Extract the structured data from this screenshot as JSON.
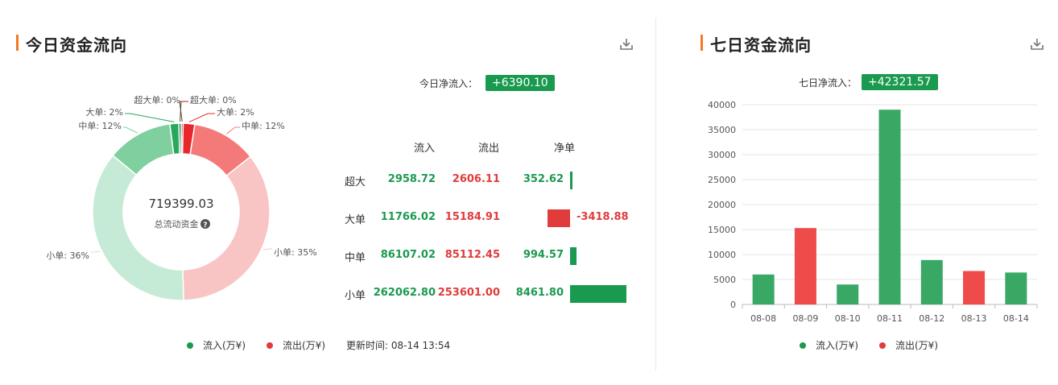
{
  "left_panel": {
    "title": "今日资金流向",
    "net_inflow_label": "今日净流入：",
    "net_inflow_value": "+6390.10",
    "donut_center_value": "719399.03",
    "donut_center_label": "总流动资金",
    "table_headers": [
      "流入",
      "流出",
      "净单"
    ],
    "rows": [
      {
        "name": "超大",
        "inflow": "2958.72",
        "outflow": "2606.11",
        "net": "352.62",
        "net_value": 352.62
      },
      {
        "name": "大单",
        "inflow": "11766.02",
        "outflow": "15184.91",
        "net": "-3418.88",
        "net_value": -3418.88
      },
      {
        "name": "中单",
        "inflow": "86107.02",
        "outflow": "85112.45",
        "net": "994.57",
        "net_value": 994.57
      },
      {
        "name": "小单",
        "inflow": "262062.80",
        "outflow": "253601.00",
        "net": "8461.80",
        "net_value": 8461.8
      }
    ],
    "legend": {
      "inflow": "流入(万¥)",
      "outflow": "流出(万¥)"
    },
    "updated": "更新时间: 08-14 13:54"
  },
  "right_panel": {
    "title": "七日资金流向",
    "net_inflow_label": "七日净流入：",
    "net_inflow_value": "+42321.57",
    "legend": {
      "inflow": "流入(万¥)",
      "outflow": "流出(万¥)"
    }
  },
  "colors": {
    "green": "#1a9a4f",
    "red": "#e03c3c",
    "bar_green": "#3aa865",
    "bar_red": "#ef4b4b",
    "accent": "#f47920"
  },
  "chart_data": [
    {
      "type": "pie",
      "variant": "donut",
      "slices": [
        {
          "label": "超大单: 0%",
          "group": "outflow",
          "tier": "超大单",
          "value": 2606.11,
          "color": "#b81d1d"
        },
        {
          "label": "大单: 2%",
          "group": "outflow",
          "tier": "大单",
          "value": 15184.91,
          "color": "#e8262b"
        },
        {
          "label": "中单: 12%",
          "group": "outflow",
          "tier": "中单",
          "value": 85112.45,
          "color": "#f47a7a"
        },
        {
          "label": "小单: 35%",
          "group": "outflow",
          "tier": "小单",
          "value": 253601.0,
          "color": "#f9c4c4"
        },
        {
          "label": "小单: 36%",
          "group": "inflow",
          "tier": "小单",
          "value": 262062.8,
          "color": "#c5ead5"
        },
        {
          "label": "中单: 12%",
          "group": "inflow",
          "tier": "中单",
          "value": 86107.02,
          "color": "#7fd09e"
        },
        {
          "label": "大单: 2%",
          "group": "inflow",
          "tier": "大单",
          "value": 11766.02,
          "color": "#27a85b"
        },
        {
          "label": "超大单: 0%",
          "group": "inflow",
          "tier": "超大单",
          "value": 2958.72,
          "color": "#136d39"
        }
      ]
    },
    {
      "type": "bar",
      "categories": [
        "08-08",
        "08-09",
        "08-10",
        "08-11",
        "08-12",
        "08-13",
        "08-14"
      ],
      "values": [
        6000,
        15300,
        4000,
        39000,
        8900,
        6700,
        6400
      ],
      "colors": [
        "#3aa865",
        "#ef4b4b",
        "#3aa865",
        "#3aa865",
        "#3aa865",
        "#ef4b4b",
        "#3aa865"
      ],
      "ylim": [
        0,
        40000
      ],
      "yticks": [
        0,
        5000,
        10000,
        15000,
        20000,
        25000,
        30000,
        35000,
        40000
      ],
      "grid": true
    }
  ]
}
